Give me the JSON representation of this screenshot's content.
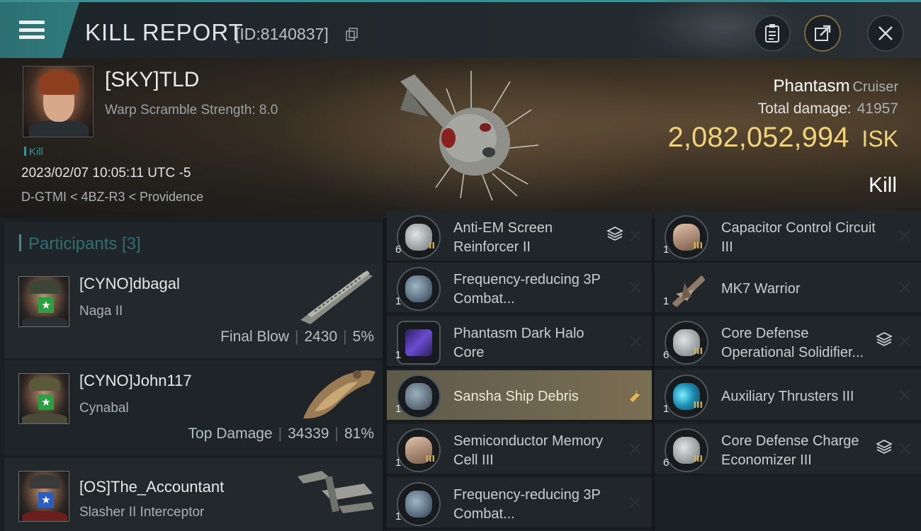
{
  "header": {
    "title": "KILL REPORT",
    "report_id": "[ID:8140837]"
  },
  "victim": {
    "name": "[SKY]TLD",
    "warp_scramble": "Warp Scramble Strength: 8.0",
    "tag": "Kill",
    "timestamp": "2023/02/07 10:05:11 UTC -5",
    "location": "D-GTMI < 4BZ-R3 < Providence",
    "ship_name": "Phantasm",
    "ship_class": "Cruiser",
    "total_damage_label": "Total damage:",
    "total_damage": "41957",
    "isk_value": "2,082,052,994",
    "isk_unit": "ISK",
    "result": "Kill"
  },
  "participants": {
    "label": "Participants [3]",
    "list": [
      {
        "name": "[CYNO]dbagal",
        "ship": "Naga II",
        "stat_label": "Final Blow",
        "damage": "2430",
        "percent": "5%",
        "badge_color": "#2e9e43"
      },
      {
        "name": "[CYNO]John117",
        "ship": "Cynabal",
        "stat_label": "Top Damage",
        "damage": "34339",
        "percent": "81%",
        "badge_color": "#2e9e43"
      },
      {
        "name": "[OS]The_Accountant",
        "ship": "Slasher II Interceptor",
        "stat_label": "",
        "damage": "",
        "percent": "",
        "badge_color": "#2a5ec4"
      }
    ]
  },
  "modules_left": [
    {
      "qty": "6",
      "name": "Anti-EM Screen Reinforcer II",
      "meta": "II",
      "icon": "shield-module-icon",
      "status": "destroyed",
      "stacked": true
    },
    {
      "qty": "1",
      "name": "Frequency-reducing 3P Combat...",
      "meta": "",
      "icon": "rig-module-icon",
      "status": "destroyed",
      "stacked": false
    },
    {
      "qty": "1",
      "name": "Phantasm Dark Halo Core",
      "meta": "",
      "icon": "core-module-icon",
      "status": "destroyed",
      "stacked": false
    },
    {
      "qty": "1",
      "name": "Sansha Ship Debris",
      "meta": "",
      "icon": "debris-icon",
      "status": "dropped",
      "stacked": false
    },
    {
      "qty": "1",
      "name": "Semiconductor Memory Cell III",
      "meta": "III",
      "icon": "capacitor-module-icon",
      "status": "destroyed",
      "stacked": false
    },
    {
      "qty": "1",
      "name": "Frequency-reducing 3P Combat...",
      "meta": "",
      "icon": "rig-module-icon",
      "status": "destroyed",
      "stacked": false
    }
  ],
  "modules_right": [
    {
      "qty": "1",
      "name": "Capacitor Control Circuit III",
      "meta": "III",
      "icon": "capacitor-module-icon",
      "status": "destroyed",
      "stacked": false
    },
    {
      "qty": "1",
      "name": "MK7  Warrior",
      "meta": "",
      "icon": "drone-icon",
      "status": "destroyed",
      "stacked": false
    },
    {
      "qty": "6",
      "name": "Core Defense Operational Solidifier...",
      "meta": "III",
      "icon": "shield-module-icon",
      "status": "destroyed",
      "stacked": true
    },
    {
      "qty": "1",
      "name": "Auxiliary Thrusters III",
      "meta": "III",
      "icon": "thruster-module-icon",
      "status": "destroyed",
      "stacked": false
    },
    {
      "qty": "6",
      "name": "Core Defense Charge Economizer III",
      "meta": "III",
      "icon": "shield-module-icon",
      "status": "destroyed",
      "stacked": true
    }
  ],
  "colors": {
    "accent": "#3f8f92",
    "isk": "#f0d27a",
    "selected_row": "#6e6650"
  }
}
